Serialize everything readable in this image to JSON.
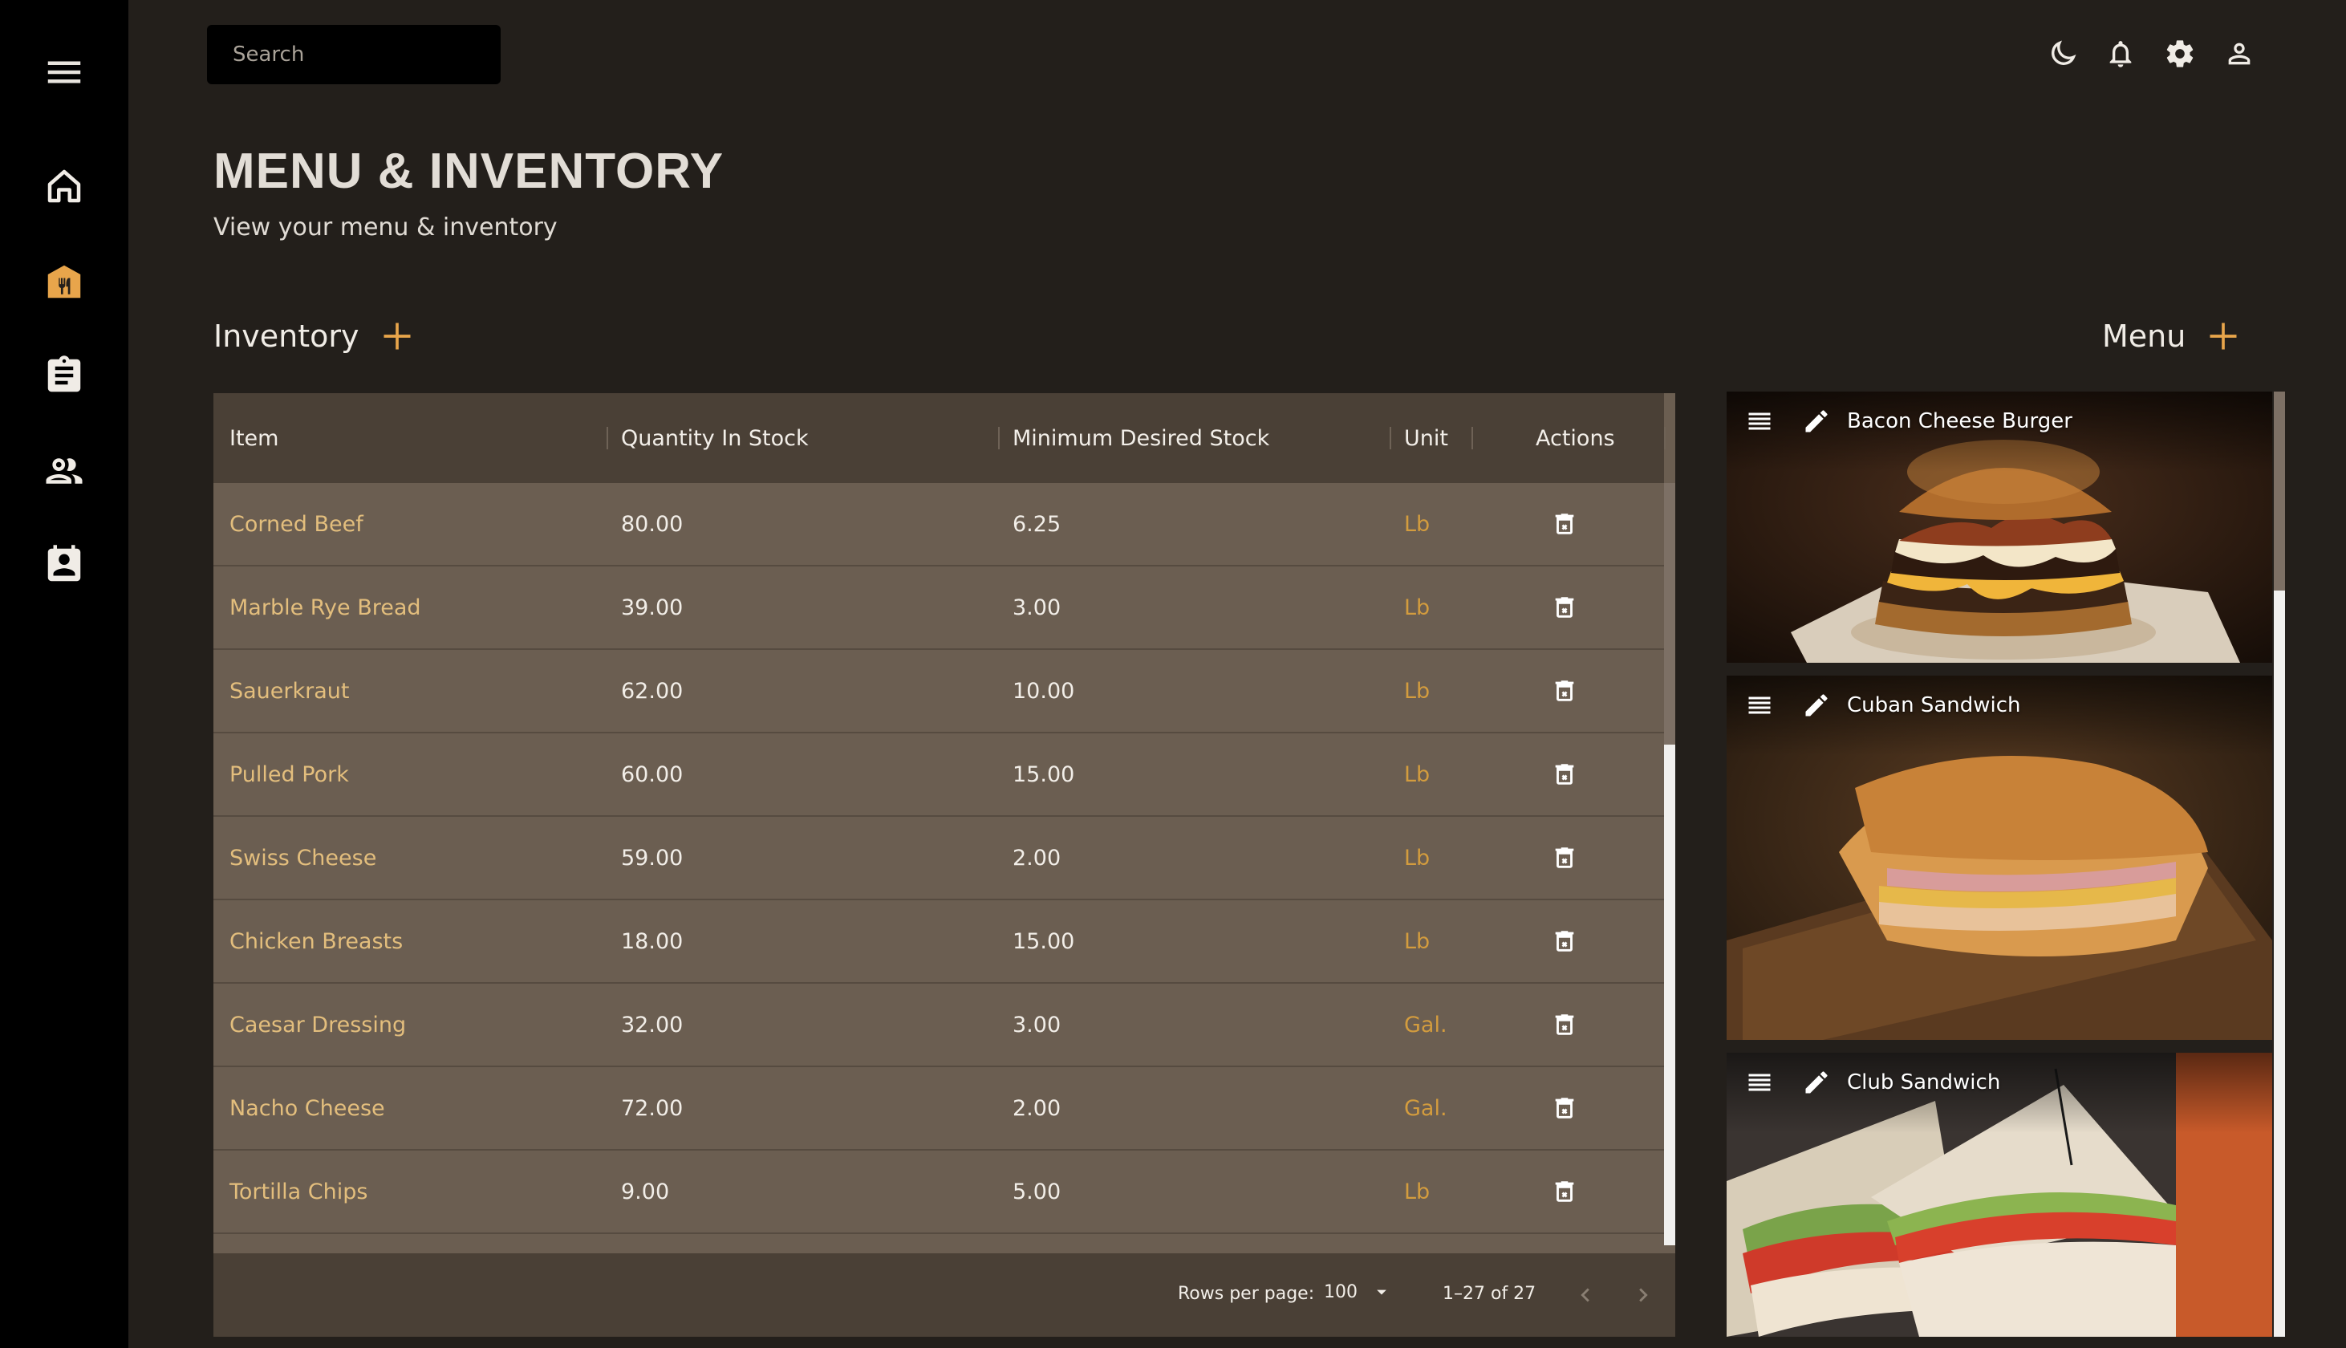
{
  "sidebar": {
    "items": [
      {
        "icon": "menu-icon",
        "active": false
      },
      {
        "icon": "home-icon",
        "active": false
      },
      {
        "icon": "storefront-icon",
        "active": true
      },
      {
        "icon": "clipboard-icon",
        "active": false
      },
      {
        "icon": "people-icon",
        "active": false
      },
      {
        "icon": "contact-card-icon",
        "active": false
      }
    ]
  },
  "topbar": {
    "search_placeholder": "Search",
    "icons": [
      "dark-mode-icon",
      "notifications-icon",
      "settings-icon",
      "account-icon"
    ]
  },
  "header": {
    "title": "MENU & INVENTORY",
    "subtitle": "View your menu & inventory"
  },
  "inventory": {
    "title": "Inventory",
    "columns": [
      "Item",
      "Quantity In Stock",
      "Minimum Desired Stock",
      "Unit",
      "Actions"
    ],
    "rows": [
      {
        "item": "Corned Beef",
        "qty": "80.00",
        "min": "6.25",
        "unit": "Lb"
      },
      {
        "item": "Marble Rye Bread",
        "qty": "39.00",
        "min": "3.00",
        "unit": "Lb"
      },
      {
        "item": "Sauerkraut",
        "qty": "62.00",
        "min": "10.00",
        "unit": "Lb"
      },
      {
        "item": "Pulled Pork",
        "qty": "60.00",
        "min": "15.00",
        "unit": "Lb"
      },
      {
        "item": "Swiss Cheese",
        "qty": "59.00",
        "min": "2.00",
        "unit": "Lb"
      },
      {
        "item": "Chicken Breasts",
        "qty": "18.00",
        "min": "15.00",
        "unit": "Lb"
      },
      {
        "item": "Caesar Dressing",
        "qty": "32.00",
        "min": "3.00",
        "unit": "Gal."
      },
      {
        "item": "Nacho Cheese",
        "qty": "72.00",
        "min": "2.00",
        "unit": "Gal."
      },
      {
        "item": "Tortilla Chips",
        "qty": "9.00",
        "min": "5.00",
        "unit": "Lb"
      }
    ],
    "footer": {
      "rows_per_page_label": "Rows per page:",
      "rows_per_page_value": "100",
      "range": "1–27 of 27"
    }
  },
  "menu": {
    "title": "Menu",
    "items": [
      {
        "name": "Bacon Cheese Burger"
      },
      {
        "name": "Cuban Sandwich"
      },
      {
        "name": "Club Sandwich"
      }
    ]
  },
  "colors": {
    "accent": "#e8a54b",
    "sidebar_bg": "#000000",
    "page_bg": "#231f1b",
    "table_row_bg": "#6b5e51",
    "table_header_bg": "#4a4036",
    "item_text": "#e3be7d",
    "unit_text": "#d39c3e"
  }
}
